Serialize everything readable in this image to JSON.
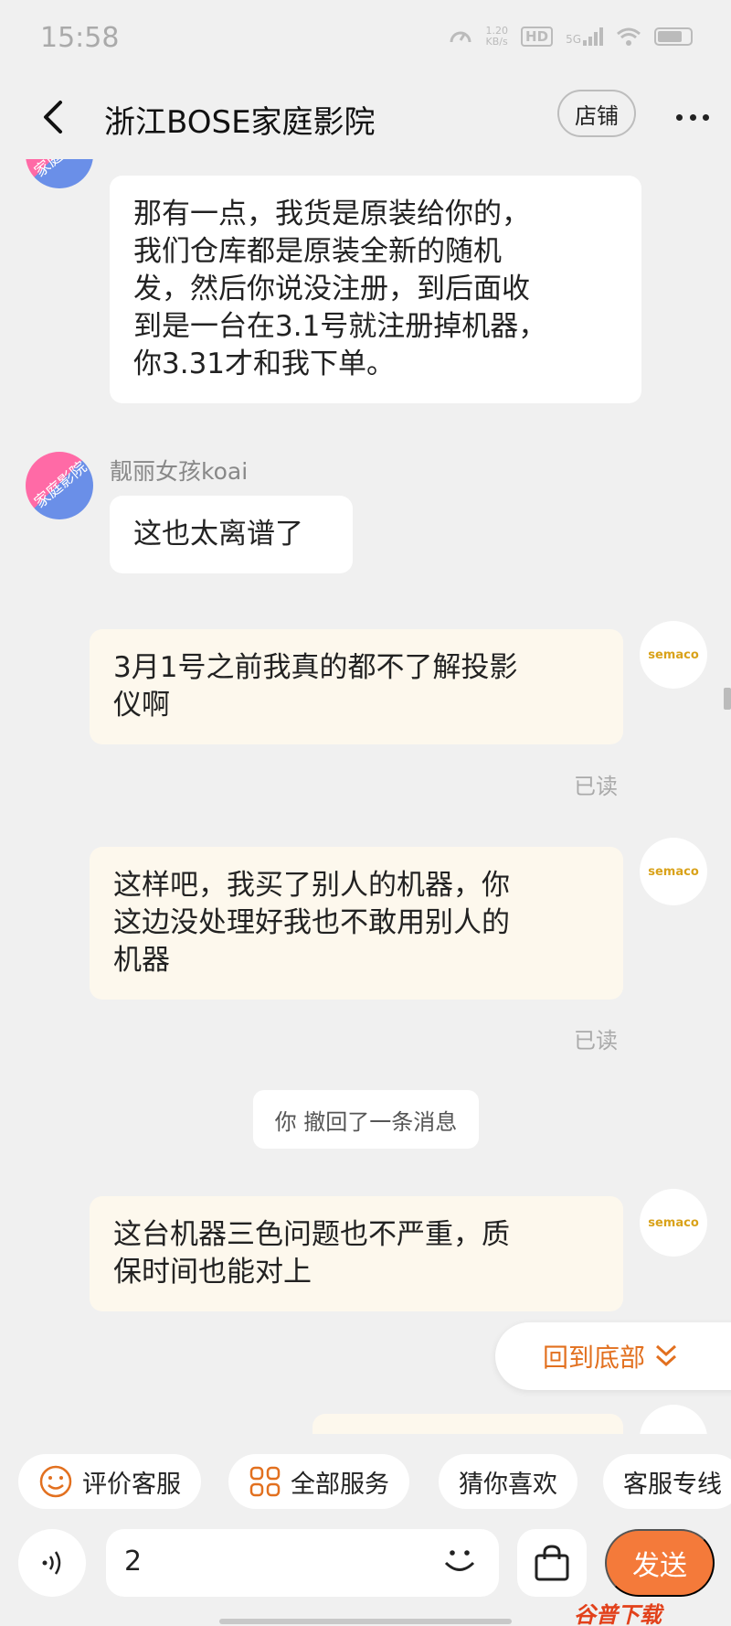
{
  "status_bar": {
    "time": "15:58",
    "net_speed_top": "1.20",
    "net_speed_bottom": "KB/s",
    "hd": "HD",
    "signal": "5G"
  },
  "header": {
    "back_icon": "chevron-left-icon",
    "title": "浙江BOSE家庭影院",
    "shop_label": "店铺",
    "more_icon": "more-dots-icon"
  },
  "messages": [
    {
      "side": "left",
      "text_lines": [
        "那有一点，我货是原装给你的，",
        "我们仓库都是原装全新的随机",
        "发，然后你说没注册，到后面收",
        "到是一台在3.1号就注册掉机器，",
        "你3.31才和我下单。"
      ]
    },
    {
      "side": "left",
      "sender": "靓丽女孩koai",
      "text": "这也太离谱了"
    },
    {
      "side": "right",
      "text_lines": [
        "3月1号之前我真的都不了解投影",
        "仪啊"
      ],
      "status": "已读"
    },
    {
      "side": "right",
      "text_lines": [
        "这样吧，我买了别人的机器，你",
        "这边没处理好我也不敢用别人的",
        "机器"
      ],
      "status": "已读"
    },
    {
      "side": "system",
      "text": "你 撤回了一条消息"
    },
    {
      "side": "right",
      "text_lines": [
        "这台机器三色问题也不严重，质",
        "保时间也能对上"
      ]
    }
  ],
  "avatars": {
    "shop_avatar_text": "家庭影院",
    "user_avatar_text": "semaco"
  },
  "back_to_bottom": "回到底部",
  "quick_actions": [
    {
      "label": "评价客服",
      "icon": "smile-icon"
    },
    {
      "label": "全部服务",
      "icon": "grid-icon"
    },
    {
      "label": "猜你喜欢",
      "icon": ""
    },
    {
      "label": "客服专线",
      "icon": ""
    }
  ],
  "input": {
    "value": "2",
    "voice_icon": "voice-icon",
    "emoji_icon": "emoji-icon",
    "bag_icon": "shopping-bag-icon",
    "send_label": "发送"
  },
  "watermark": "谷普下载",
  "colors": {
    "accent": "#f47a3a",
    "bubble_mine": "#fdf8ed",
    "bubble_theirs": "#ffffff",
    "background": "#f0f0f0"
  }
}
